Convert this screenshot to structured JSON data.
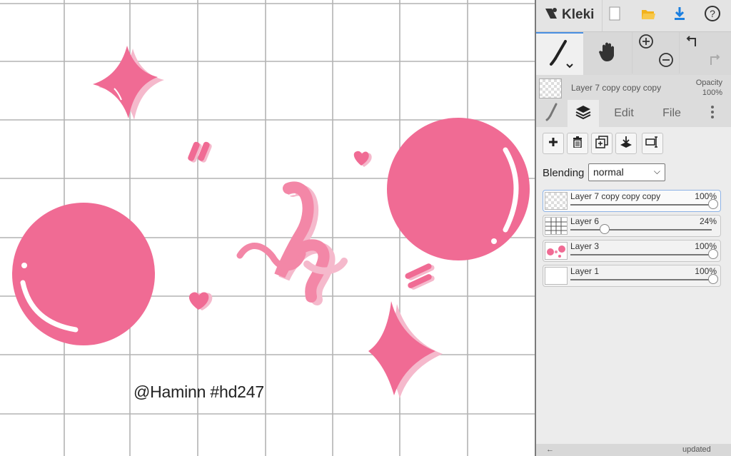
{
  "canvas": {
    "watermark": "@Haminn #hd247",
    "artwork_color": "#f06b94",
    "shadow_color": "#f5b9cc"
  },
  "app": {
    "name": "Kleki",
    "top_icons": [
      "new-image-icon",
      "open-folder-icon",
      "save-download-icon",
      "help-icon"
    ]
  },
  "tools": {
    "items": [
      "brush-icon",
      "hand-icon",
      "zoom-in-icon",
      "zoom-out-icon",
      "undo-icon",
      "redo-icon"
    ],
    "active": "brush"
  },
  "current_layer": {
    "name": "Layer 7 copy copy copy",
    "opacity_label": "Opacity",
    "opacity_value": "100%"
  },
  "tabs": {
    "items": [
      {
        "icon": "brush-tab-icon"
      },
      {
        "icon": "layers-tab-icon",
        "active": true
      },
      {
        "label": "Edit"
      },
      {
        "label": "File"
      }
    ],
    "edit_label": "Edit",
    "file_label": "File"
  },
  "layer_actions": [
    "add-layer-icon",
    "delete-layer-icon",
    "duplicate-layer-icon",
    "merge-down-icon",
    "rename-layer-icon"
  ],
  "blending": {
    "label": "Blending",
    "value": "normal"
  },
  "layers": [
    {
      "name": "Layer 7 copy copy copy",
      "opacity": "100%",
      "level": 1.0,
      "active": true
    },
    {
      "name": "Layer 6",
      "opacity": "24%",
      "level": 0.24,
      "active": false
    },
    {
      "name": "Layer 3",
      "opacity": "100%",
      "level": 1.0,
      "active": false
    },
    {
      "name": "Layer 1",
      "opacity": "100%",
      "level": 1.0,
      "active": false
    }
  ],
  "bottom_bar": {
    "updated": "updated"
  }
}
